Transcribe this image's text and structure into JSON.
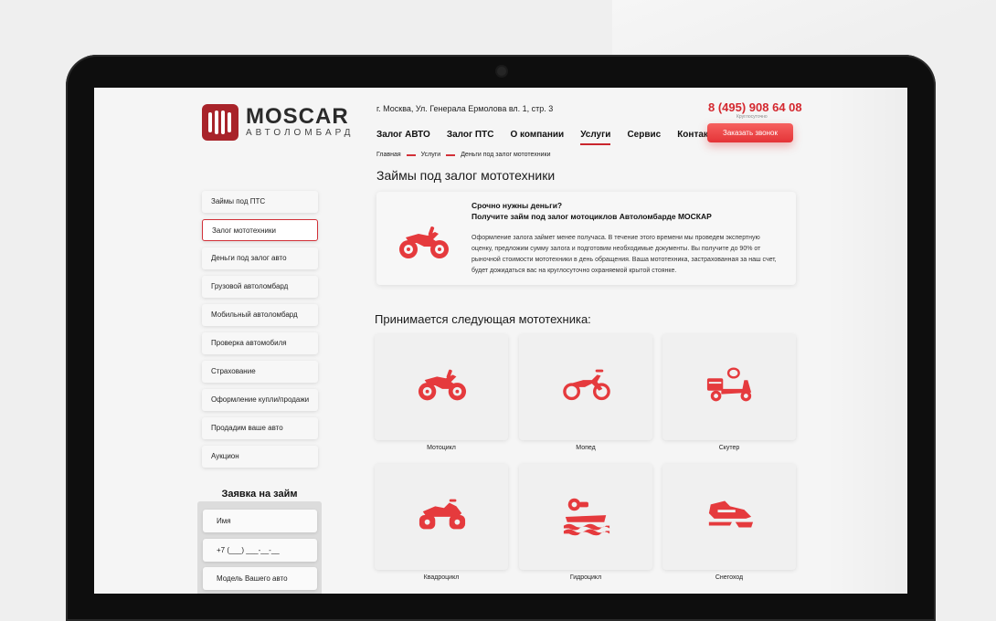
{
  "brand": {
    "name": "MOSCAR",
    "subtitle": "АВТОЛОМБАРД",
    "color": "#a8232a"
  },
  "header": {
    "address": "г. Москва, Ул. Генерала Ермолова вл. 1, стр. 3",
    "phone": "8 (495) 908 64 08",
    "phone_note": "Круглосуточно",
    "call_button": "Заказать звонок",
    "nav": [
      {
        "label": "Залог АВТО",
        "active": false
      },
      {
        "label": "Залог ПТС",
        "active": false
      },
      {
        "label": "О компании",
        "active": false
      },
      {
        "label": "Услуги",
        "active": true
      },
      {
        "label": "Сервис",
        "active": false
      },
      {
        "label": "Контакты",
        "active": false
      }
    ]
  },
  "breadcrumb": [
    "Главная",
    "Услуги",
    "Деньги под залог мототехники"
  ],
  "page_title": "Займы под залог мототехники",
  "sidebar": {
    "items": [
      {
        "label": "Займы под ПТС",
        "active": false
      },
      {
        "label": "Залог мототехники",
        "active": true
      },
      {
        "label": "Деньги под залог авто",
        "active": false
      },
      {
        "label": "Грузовой автоломбард",
        "active": false
      },
      {
        "label": "Мобильный автоломбард",
        "active": false
      },
      {
        "label": "Проверка автомобиля",
        "active": false
      },
      {
        "label": "Страхование",
        "active": false
      },
      {
        "label": "Оформление купли/продажи",
        "active": false
      },
      {
        "label": "Продадим ваше авто",
        "active": false
      },
      {
        "label": "Аукцион",
        "active": false
      }
    ]
  },
  "loan_form": {
    "title": "Заявка на займ",
    "name_placeholder": "Имя",
    "phone_placeholder": "+7 (___) ___-__-__",
    "model_placeholder": "Модель Вашего авто"
  },
  "intro": {
    "heading_1": "Срочно нужны деньги?",
    "heading_2": "Получите займ под залог мотоциклов Автоломбарде МОСКАР",
    "text": "Оформление залога займет менее получаса. В течение этого времени мы проведем экспертную оценку, предложим сумму залога и подготовим необходимые документы. Вы получите до 90% от рыночной стоимости мототехники в день обращения. Ваша мототехника, застрахованная за наш счет, будет дожидаться вас на круглосуточно охраняемой крытой стоянке."
  },
  "vehicles": {
    "title": "Принимается следующая мототехника:",
    "items": [
      {
        "label": "Мотоцикл",
        "icon": "motorcycle-icon"
      },
      {
        "label": "Мопед",
        "icon": "moped-icon"
      },
      {
        "label": "Скутер",
        "icon": "scooter-icon"
      },
      {
        "label": "Квадроцикл",
        "icon": "quad-bike-icon"
      },
      {
        "label": "Гидроцикл",
        "icon": "jet-ski-icon"
      },
      {
        "label": "Снегоход",
        "icon": "snowmobile-icon"
      }
    ]
  },
  "accent_color": "#e53a3d"
}
